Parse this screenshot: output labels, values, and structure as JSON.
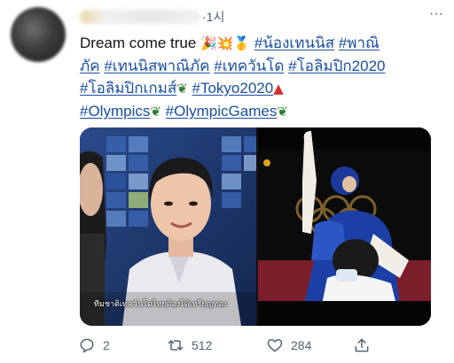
{
  "tweet": {
    "time": "·1시",
    "more_icon": "···",
    "lines": [
      {
        "segments": [
          {
            "type": "text",
            "text": "Dream come true "
          },
          {
            "type": "emoji",
            "icon": "party-popper-icon",
            "glyph": "🎉",
            "cls": "party"
          },
          {
            "type": "emoji",
            "icon": "collision-icon",
            "glyph": "💥",
            "cls": "red"
          },
          {
            "type": "emoji",
            "icon": "gold-medal-icon",
            "glyph": "🥇",
            "cls": "gold"
          },
          {
            "type": "text",
            "text": " "
          },
          {
            "type": "hashtag",
            "text": "#น้องเทนนิส"
          },
          {
            "type": "text",
            "text": " "
          },
          {
            "type": "hashtag",
            "text": "#พาณิ"
          }
        ]
      },
      {
        "segments": [
          {
            "type": "hashtag",
            "text": "ภัค"
          },
          {
            "type": "text",
            "text": " "
          },
          {
            "type": "hashtag",
            "text": "#เทนนิสพาณิภัค"
          },
          {
            "type": "text",
            "text": " "
          },
          {
            "type": "hashtag",
            "text": "#เทควันโด"
          },
          {
            "type": "text",
            "text": " "
          },
          {
            "type": "hashtag",
            "text": "#โอลิมปิก2020"
          }
        ]
      },
      {
        "segments": [
          {
            "type": "hashtag",
            "text": "#โอลิมปิกเกมส์"
          },
          {
            "type": "emoji",
            "icon": "laurel-wreath-icon",
            "glyph": "❦",
            "cls": "wreath"
          },
          {
            "type": "text",
            "text": " "
          },
          {
            "type": "hashtag",
            "text": "#Tokyo2020"
          },
          {
            "type": "emoji",
            "icon": "tokyo-tower-icon",
            "glyph": "▲",
            "cls": "red"
          }
        ]
      },
      {
        "segments": [
          {
            "type": "hashtag",
            "text": "#Olympics"
          },
          {
            "type": "emoji",
            "icon": "laurel-wreath-icon",
            "glyph": "❦",
            "cls": "wreath"
          },
          {
            "type": "text",
            "text": " "
          },
          {
            "type": "hashtag",
            "text": "#OlympicGames"
          },
          {
            "type": "emoji",
            "icon": "laurel-wreath-icon",
            "glyph": "❦",
            "cls": "wreath"
          }
        ]
      }
    ],
    "media": {
      "left_caption": "ทีมชาติเทควันโดไทยต้องได้เหรียญทอง"
    },
    "actions": {
      "reply_count": "2",
      "retweet_count": "512",
      "like_count": "284"
    }
  },
  "colors": {
    "hashtag": "#1a4fa0",
    "meta": "#536471",
    "text": "#0f1419"
  }
}
